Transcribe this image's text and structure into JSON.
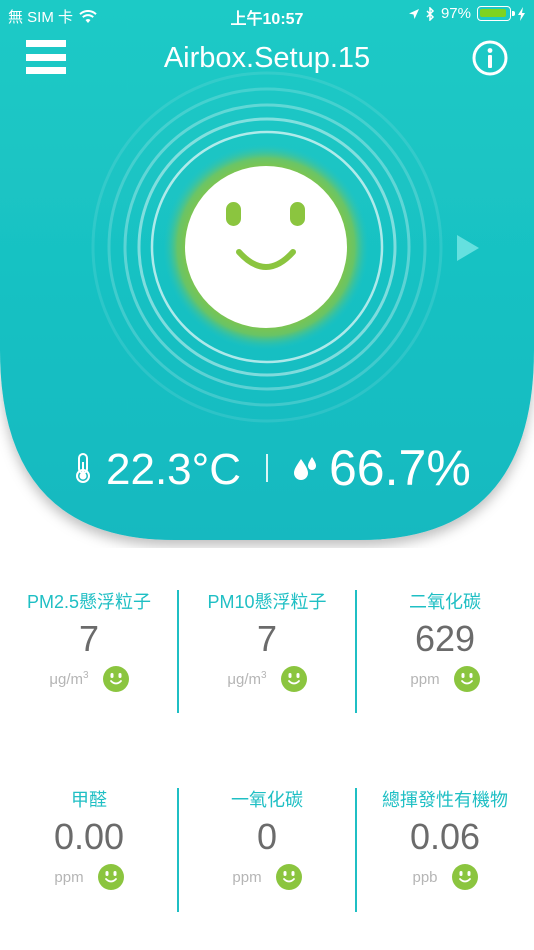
{
  "status_bar": {
    "carrier": "無 SIM 卡",
    "time": "上午10:57",
    "battery_percent": "97%",
    "battery_level": 0.97
  },
  "header": {
    "title": "Airbox.Setup.15",
    "menu_icon": "hamburger-menu-icon",
    "info_icon": "info-icon"
  },
  "status_face": {
    "mood": "happy",
    "ring_color": "#8bc53f"
  },
  "readings": {
    "temperature": "22.3°C",
    "humidity": "66.7%"
  },
  "metrics": [
    {
      "label": "PM2.5懸浮粒子",
      "value": "7",
      "unit": "μg/m",
      "unit_sup": "3",
      "status": "good"
    },
    {
      "label": "PM10懸浮粒子",
      "value": "7",
      "unit": "μg/m",
      "unit_sup": "3",
      "status": "good"
    },
    {
      "label": "二氧化碳",
      "value": "629",
      "unit": "ppm",
      "unit_sup": "",
      "status": "good"
    },
    {
      "label": "甲醛",
      "value": "0.00",
      "unit": "ppm",
      "unit_sup": "",
      "status": "good"
    },
    {
      "label": "一氧化碳",
      "value": "0",
      "unit": "ppm",
      "unit_sup": "",
      "status": "good"
    },
    {
      "label": "總揮發性有機物",
      "value": "0.06",
      "unit": "ppb",
      "unit_sup": "",
      "status": "good"
    }
  ],
  "colors": {
    "teal": "#1fbfc4",
    "green": "#8bc53f",
    "value_gray": "#6b6b6b",
    "unit_gray": "#b5b5b5"
  }
}
